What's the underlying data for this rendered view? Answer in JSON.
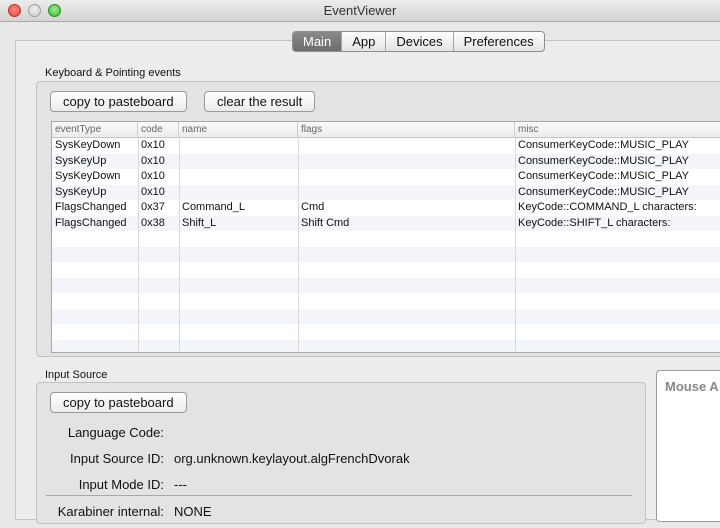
{
  "window": {
    "title": "EventViewer"
  },
  "tabs": [
    {
      "label": "Main",
      "active": true
    },
    {
      "label": "App",
      "active": false
    },
    {
      "label": "Devices",
      "active": false
    },
    {
      "label": "Preferences",
      "active": false
    }
  ],
  "keyboard": {
    "section_label": "Keyboard & Pointing events",
    "copy_label": "copy to pasteboard",
    "clear_label": "clear the result",
    "columns": [
      "eventType",
      "code",
      "name",
      "flags",
      "misc"
    ],
    "rows": [
      [
        "SysKeyDown",
        "0x10",
        "",
        "",
        "ConsumerKeyCode::MUSIC_PLAY"
      ],
      [
        "SysKeyUp",
        "0x10",
        "",
        "",
        "ConsumerKeyCode::MUSIC_PLAY"
      ],
      [
        "SysKeyDown",
        "0x10",
        "",
        "",
        "ConsumerKeyCode::MUSIC_PLAY"
      ],
      [
        "SysKeyUp",
        "0x10",
        "",
        "",
        "ConsumerKeyCode::MUSIC_PLAY"
      ],
      [
        "FlagsChanged",
        "0x37",
        "Command_L",
        "Cmd",
        "KeyCode::COMMAND_L     characters:"
      ],
      [
        "FlagsChanged",
        "0x38",
        "Shift_L",
        "Shift Cmd",
        "KeyCode::SHIFT_L     characters:"
      ]
    ]
  },
  "input_source": {
    "section_label": "Input Source",
    "copy_label": "copy to pasteboard",
    "language_code_label": "Language Code:",
    "language_code_value": "",
    "input_source_id_label": "Input Source ID:",
    "input_source_id_value": "org.unknown.keylayout.algFrenchDvorak",
    "input_mode_id_label": "Input Mode ID:",
    "input_mode_id_value": "---",
    "karabiner_label": "Karabiner internal:",
    "karabiner_value": "NONE"
  },
  "mouse": {
    "title": "Mouse A"
  },
  "colors": {
    "active_tab": "#7a7a7a",
    "row_stripe": "#f2f5fa",
    "close": "#e0443e",
    "minimize": "#c9c9c9",
    "maximize": "#35b42b"
  }
}
